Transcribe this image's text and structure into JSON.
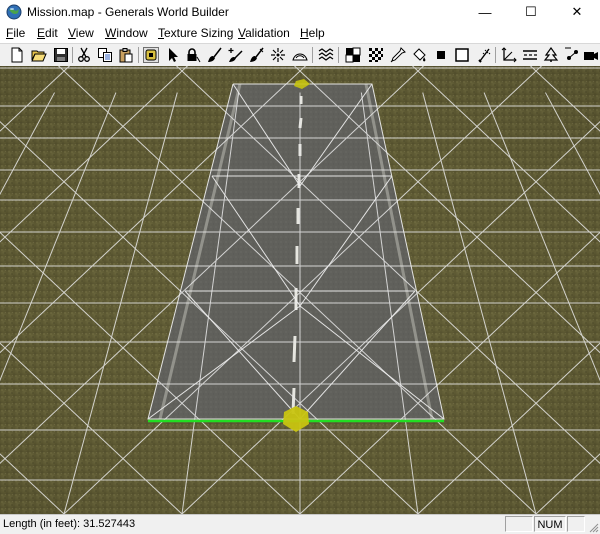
{
  "window": {
    "title": "Mission.map - Generals World Builder",
    "minimize_glyph": "—",
    "maximize_glyph": "☐",
    "close_glyph": "✕"
  },
  "menu": {
    "items": [
      {
        "pre": "",
        "u": "F",
        "post": "ile"
      },
      {
        "pre": "",
        "u": "E",
        "post": "dit"
      },
      {
        "pre": "",
        "u": "V",
        "post": "iew"
      },
      {
        "pre": "",
        "u": "W",
        "post": "indow"
      },
      {
        "pre": "",
        "u": "T",
        "post": "exture Sizing"
      },
      {
        "pre": "",
        "u": "V",
        "post": "alidation"
      },
      {
        "pre": "",
        "u": "H",
        "post": "elp"
      }
    ]
  },
  "toolbar": {
    "icons": [
      "new-file-icon",
      "open-folder-icon",
      "save-icon",
      "cut-icon",
      "copy-icon",
      "paste-icon",
      "object-properties-icon",
      "select-pointer-icon",
      "lock-icon",
      "brush-icon",
      "add-brush-icon",
      "feather-brush-icon",
      "smooth-brush-icon",
      "plateau-icon",
      "ramp-icon",
      "water-waves-icon",
      "tile-pattern-icon",
      "checker-pattern-icon",
      "eyedropper-icon",
      "paint-bucket-icon",
      "black-square-icon",
      "white-square-icon",
      "scorch-brush-icon",
      "axis-icon",
      "road-tool-icon",
      "tree-icon",
      "waypoint-icon",
      "camera-icon"
    ]
  },
  "status": {
    "message": "Length (in feet): 31.527443",
    "num_indicator": "NUM"
  },
  "colors": {
    "terrain": "#5f5a35",
    "road": "#4b4b46",
    "grid": "#e8e8e8",
    "selection_edge": "#22dd22",
    "handle": "#c8c410"
  }
}
